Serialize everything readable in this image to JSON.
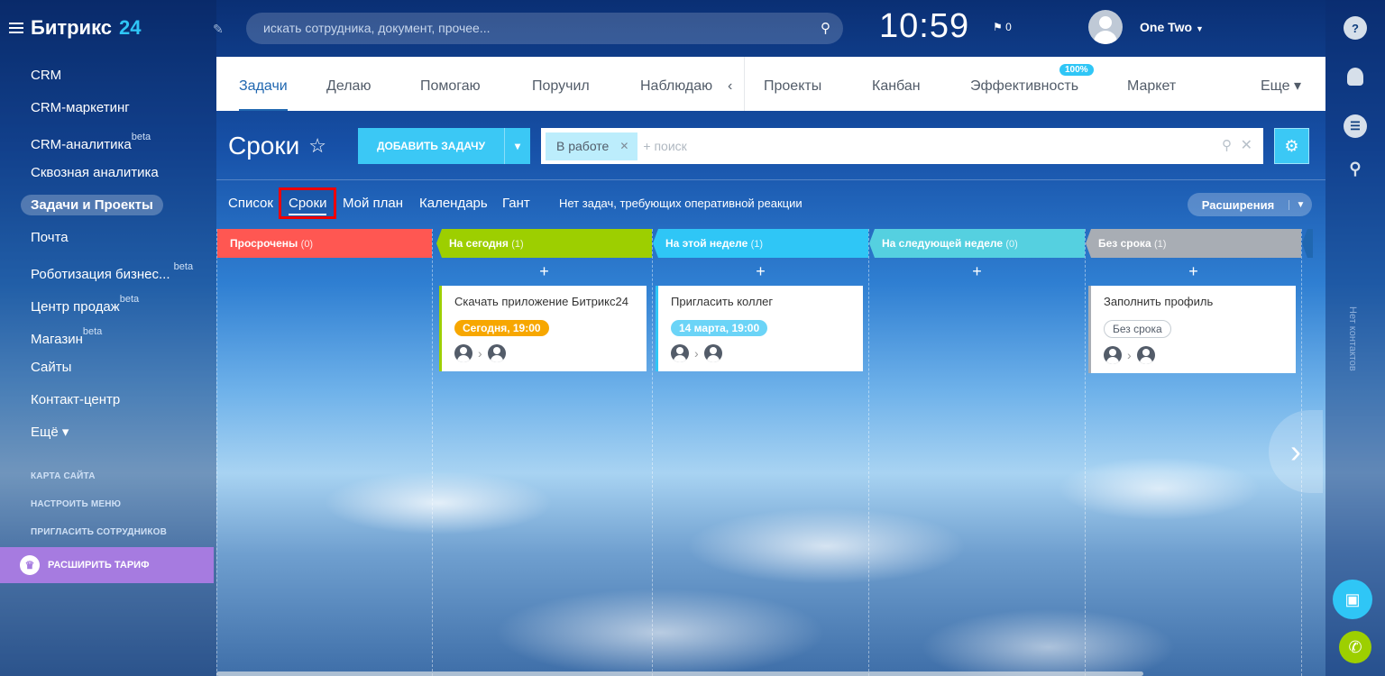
{
  "app": {
    "title": "Битрикс",
    "title_num": "24"
  },
  "search": {
    "placeholder": "искать сотрудника, документ, прочее..."
  },
  "header": {
    "time": "10:59",
    "flag_count": "0",
    "user_name": "One Two"
  },
  "sidebar": {
    "items": [
      {
        "label": "CRM"
      },
      {
        "label": "CRM-маркетинг"
      },
      {
        "label": "CRM-аналитика",
        "badge": "beta"
      },
      {
        "label": "Сквозная аналитика"
      },
      {
        "label": "Задачи и Проекты",
        "active": true
      },
      {
        "label": "Почта"
      },
      {
        "label": "Роботизация бизнес...",
        "badge": "beta"
      },
      {
        "label": "Центр продаж",
        "badge": "beta"
      },
      {
        "label": "Магазин",
        "badge": "beta"
      },
      {
        "label": "Сайты"
      },
      {
        "label": "Контакт-центр"
      },
      {
        "label": "Ещё ▾"
      }
    ],
    "links": {
      "sitemap": "КАРТА САЙТА",
      "config": "НАСТРОИТЬ МЕНЮ",
      "invite": "ПРИГЛАСИТЬ СОТРУДНИКОВ"
    },
    "tariff": "РАСШИРИТЬ ТАРИФ"
  },
  "tabs": {
    "items": [
      "Задачи",
      "Делаю",
      "Помогаю",
      "Поручил",
      "Наблюдаю",
      "Проекты",
      "Канбан",
      "Эффективность",
      "Маркет",
      "Еще ▾"
    ],
    "efficiency_badge": "100%"
  },
  "page": {
    "title": "Сроки"
  },
  "toolbar": {
    "add_task": "ДОБАВИТЬ ЗАДАЧУ",
    "filter_chip": "В работе",
    "filter_placeholder": "+ поиск"
  },
  "views": {
    "items": [
      "Список",
      "Сроки",
      "Мой план",
      "Календарь",
      "Гант"
    ],
    "no_reaction": "Нет задач, требующих оперативной реакции",
    "extensions": "Расширения"
  },
  "columns": [
    {
      "title": "Просрочены",
      "count": "(0)",
      "color": "#ff5752"
    },
    {
      "title": "На сегодня",
      "count": "(1)",
      "color": "#9dcf00"
    },
    {
      "title": "На этой неделе",
      "count": "(1)",
      "color": "#2fc6f6"
    },
    {
      "title": "На следующей неделе",
      "count": "(0)",
      "color": "#55d0e0"
    },
    {
      "title": "Без срока",
      "count": "(1)",
      "color": "#a8adb4"
    }
  ],
  "cards": [
    {
      "title": "Скачать приложение Битрикс24",
      "deadline": "Сегодня, 19:00",
      "deadline_color": "#f7a700"
    },
    {
      "title": "Пригласить коллег",
      "deadline": "14 марта, 19:00",
      "deadline_color": "#6bd4f7"
    },
    {
      "title": "Заполнить профиль",
      "deadline": "Без срока"
    }
  ],
  "rightbar": {
    "no_contacts": "Нет контактов"
  }
}
